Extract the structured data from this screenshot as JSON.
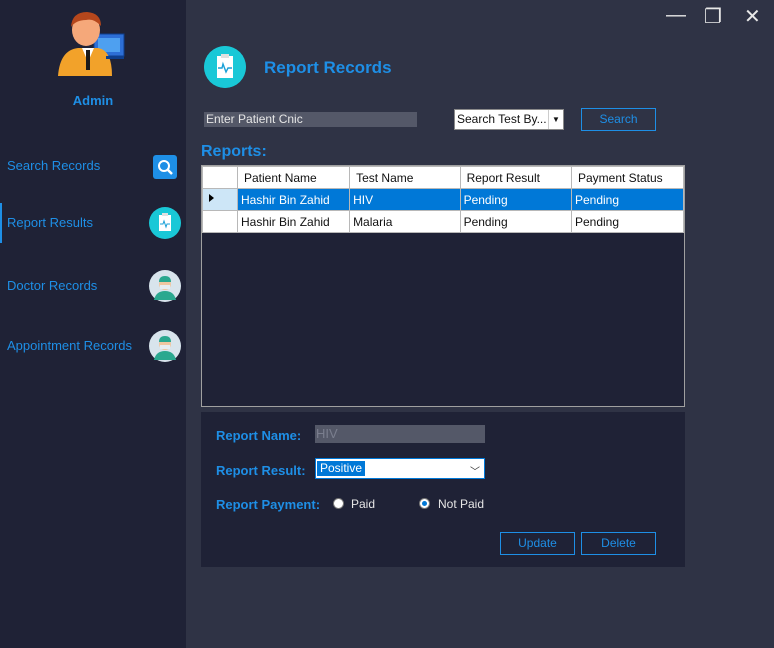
{
  "sidebar": {
    "user_label": "Admin",
    "items": [
      {
        "label": "Search Records",
        "icon": "search-icon"
      },
      {
        "label": "Report Results",
        "icon": "report-icon"
      },
      {
        "label": "Doctor Records",
        "icon": "doctor-icon"
      },
      {
        "label": "Appointment Records",
        "icon": "doctor-icon"
      }
    ],
    "active_index": 1
  },
  "window_controls": {
    "minimize": "—",
    "restore": "❐",
    "close": "✕"
  },
  "header": {
    "title": "Report Records"
  },
  "search": {
    "cnic_text": "Enter Patient Cnic",
    "search_by_text": "Search Test By...",
    "search_button": "Search"
  },
  "reports": {
    "label": "Reports:",
    "columns": [
      "Patient Name",
      "Test Name",
      "Report Result",
      "Payment Status"
    ],
    "rows": [
      [
        "Hashir Bin Zahid",
        "HIV",
        "Pending",
        "Pending"
      ],
      [
        "Hashir Bin Zahid",
        "Malaria",
        "Pending",
        "Pending"
      ]
    ],
    "selected_row": 0
  },
  "form": {
    "report_name_label": "Report Name:",
    "report_name_value": "HIV",
    "report_result_label": "Report Result:",
    "report_result_value": "Positive",
    "report_payment_label": "Report Payment:",
    "paid_label": "Paid",
    "not_paid_label": "Not Paid",
    "payment_selected": "Not Paid",
    "update_button": "Update",
    "delete_button": "Delete"
  },
  "colors": {
    "accent": "#1e8fe6",
    "sidebar_bg": "#1f2236",
    "main_bg": "#2f3345",
    "selection": "#0078d7",
    "teal_icon": "#19c8d7"
  }
}
